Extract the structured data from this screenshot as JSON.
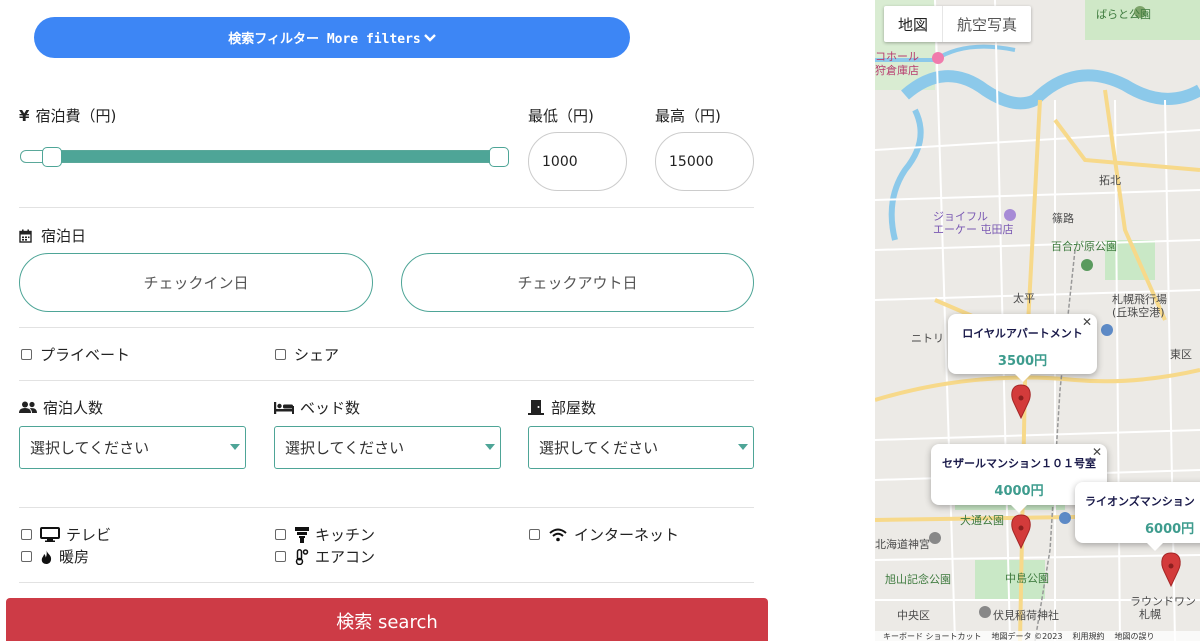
{
  "filters": {
    "toggle_label_jp": "検索フィルター",
    "toggle_label_en": "More filters",
    "price": {
      "label": "宿泊費（円)",
      "min_label": "最低（円)",
      "max_label": "最高（円)",
      "min_value": "1000",
      "max_value": "15000",
      "range_fraction": [
        0.0,
        1.0
      ]
    },
    "stay_date": {
      "label": "宿泊日",
      "checkin": "チェックイン日",
      "checkout": "チェックアウト日"
    },
    "room_type": {
      "private": "プライベート",
      "shared": "シェア"
    },
    "guests": {
      "label": "宿泊人数",
      "placeholder": "選択してください"
    },
    "beds": {
      "label": "ベッド数",
      "placeholder": "選択してください"
    },
    "rooms": {
      "label": "部屋数",
      "placeholder": "選択してください"
    },
    "amenities": {
      "tv": "テレビ",
      "kitchen": "キッチン",
      "internet": "インターネット",
      "heating": "暖房",
      "aircon": "エアコン"
    },
    "search_button": "検索 search"
  },
  "map": {
    "type_buttons": [
      "地図",
      "航空写真"
    ],
    "markers": [
      {
        "title": "ロイヤルアパートメント",
        "price": "3500円"
      },
      {
        "title": "セザールマンション１０１号室",
        "price": "4000円"
      },
      {
        "title": "ライオンズマンション",
        "price": "6000円"
      }
    ],
    "labels": [
      "ばらと公園",
      "コホール",
      "狩倉庫店",
      "拓北",
      "ジョイフル",
      "エーケー 屯田店",
      "篠路",
      "百合が原公園",
      "太平",
      "札幌飛行場",
      "(丘珠空港)",
      "ニトリ",
      "東区",
      "大通公園",
      "北海道神宮",
      "旭山記念公園",
      "中島公園",
      "伏見稲荷神社",
      "中央区",
      "ラウンドワン",
      "札幌"
    ],
    "footer": [
      "キーボード ショートカット",
      "地図データ ©2023",
      "利用規約",
      "地図の誤り"
    ],
    "colors": {
      "water": "#9fd0ea",
      "park": "#c9e8c6",
      "road": "#f7d98a"
    }
  }
}
